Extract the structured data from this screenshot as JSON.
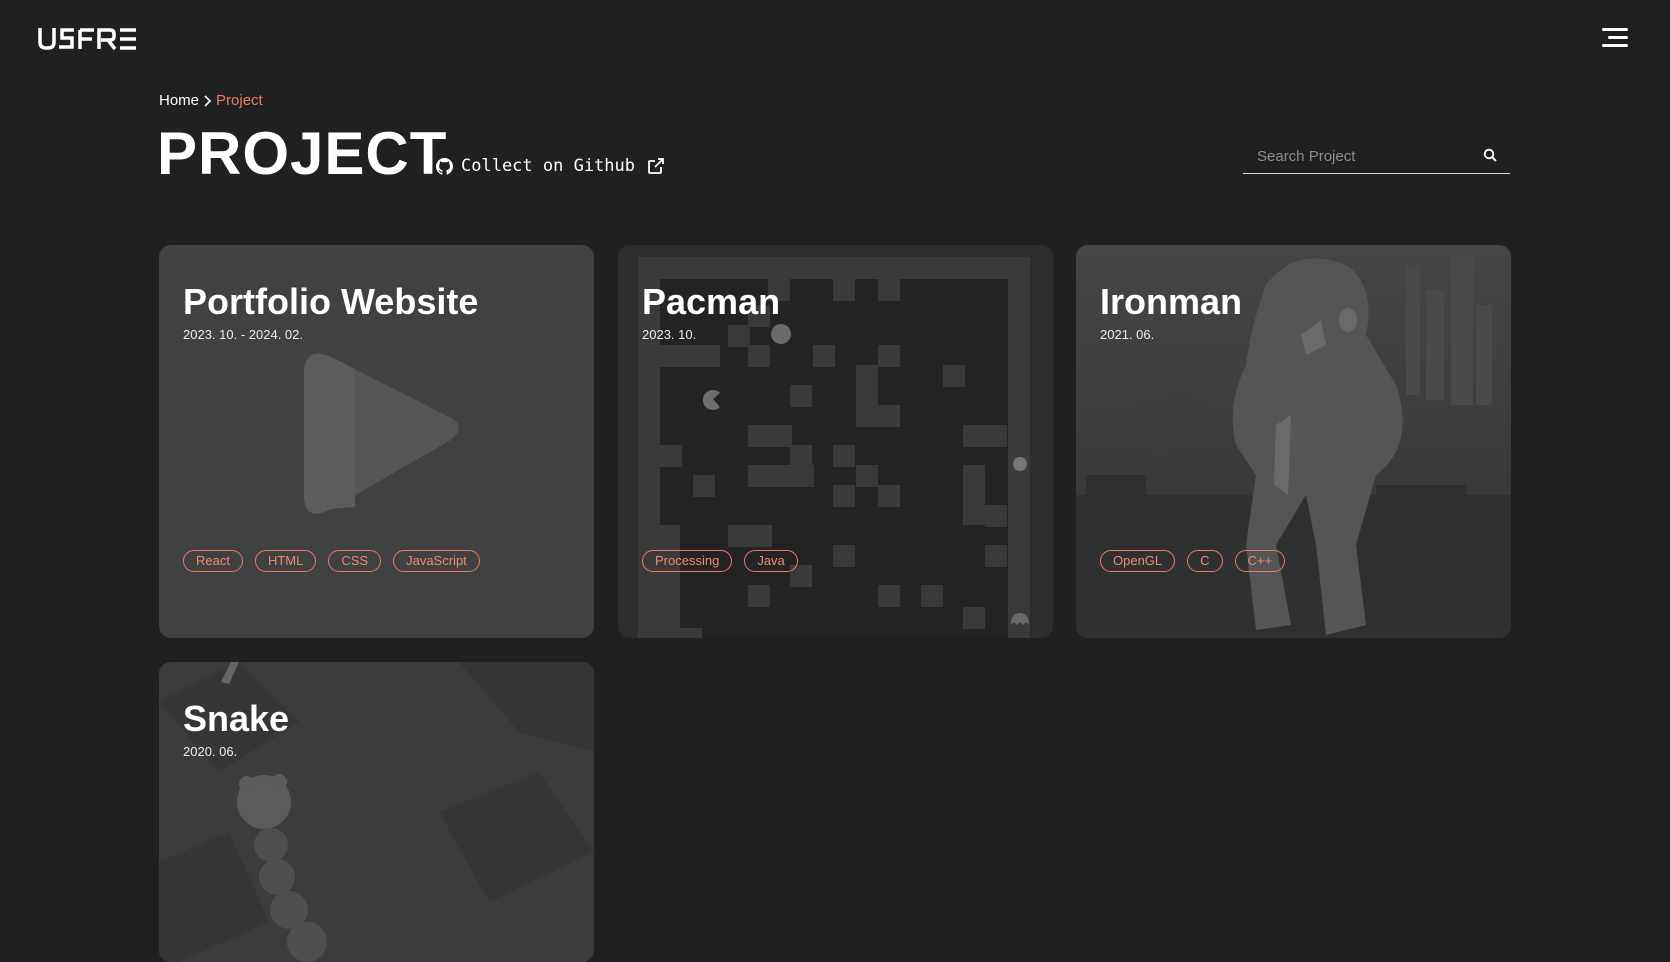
{
  "brand": {
    "logo_text": "USFREE"
  },
  "breadcrumb": {
    "home": "Home",
    "current": "Project"
  },
  "header": {
    "title": "PROJECT",
    "github_link": "Collect on Github"
  },
  "search": {
    "placeholder": "Search Project"
  },
  "colors": {
    "accent": "#f07a5e",
    "background": "#1f2022",
    "card": "#404143"
  },
  "projects": [
    {
      "title": "Portfolio Website",
      "date": "2023. 10. - 2024. 02.",
      "tags": [
        "React",
        "HTML",
        "CSS",
        "JavaScript"
      ]
    },
    {
      "title": "Pacman",
      "date": "2023. 10.",
      "tags": [
        "Processing",
        "Java"
      ]
    },
    {
      "title": "Ironman",
      "date": "2021. 06.",
      "tags": [
        "OpenGL",
        "C",
        "C++"
      ]
    },
    {
      "title": "Snake",
      "date": "2020. 06.",
      "tags": []
    }
  ]
}
